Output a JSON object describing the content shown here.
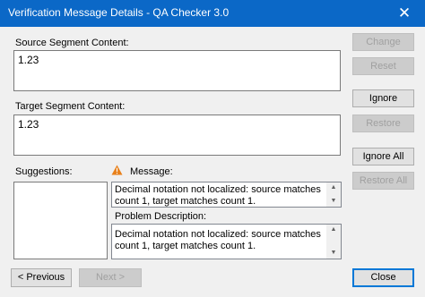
{
  "window": {
    "title": "Verification Message Details - QA Checker 3.0",
    "close_glyph": "✕"
  },
  "source": {
    "label": "Source Segment Content:",
    "value": "1.23"
  },
  "target": {
    "label": "Target Segment Content:",
    "value": "1.23"
  },
  "suggestions": {
    "label": "Suggestions:"
  },
  "message": {
    "label": "Message:",
    "text": "Decimal notation not localized: source matches count 1, target matches count 1."
  },
  "problem": {
    "label": "Problem Description:",
    "text": "Decimal notation not localized: source matches count 1, target matches count 1."
  },
  "buttons": {
    "change": "Change",
    "reset": "Reset",
    "ignore": "Ignore",
    "restore": "Restore",
    "ignore_all": "Ignore All",
    "restore_all": "Restore All",
    "previous": "< Previous",
    "next": "Next >",
    "close": "Close"
  },
  "icons": {
    "warning": "warning-icon",
    "window_close": "close-icon"
  },
  "colors": {
    "titlebar": "#0b68c7",
    "warning": "#e8801a",
    "default_button_border": "#0078d7"
  }
}
